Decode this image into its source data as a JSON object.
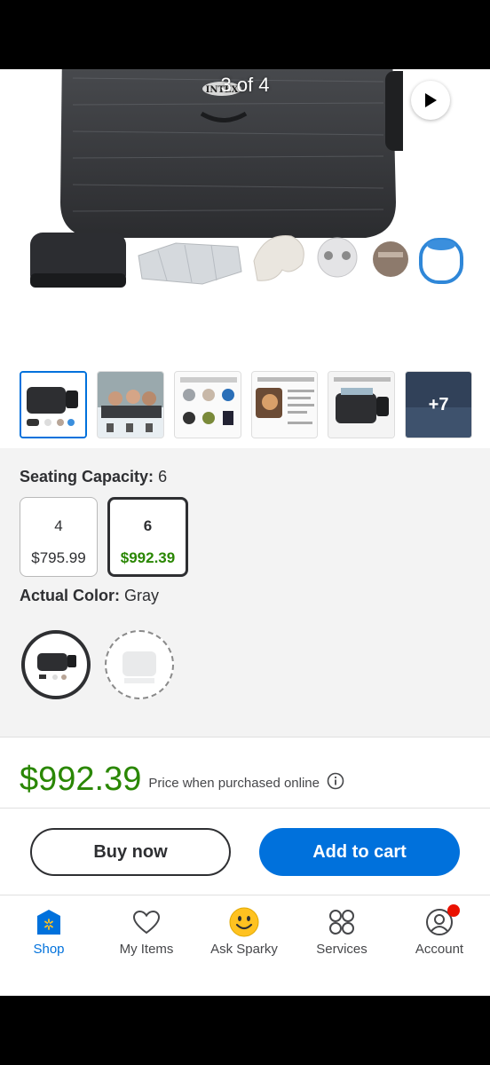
{
  "gallery": {
    "counter": "3 of 4",
    "play_label": "Play video",
    "brand_mark": "INTEX",
    "thumbnails": [
      {
        "name": "thumb-spa-set",
        "selected": true
      },
      {
        "name": "thumb-lifestyle",
        "selected": false
      },
      {
        "name": "thumb-features",
        "selected": false
      },
      {
        "name": "thumb-specs",
        "selected": false
      },
      {
        "name": "thumb-deluxe",
        "selected": false
      },
      {
        "name": "thumb-more",
        "overlay": "+7",
        "selected": false
      }
    ]
  },
  "seating": {
    "label": "Seating Capacity:",
    "value": "6",
    "options": [
      {
        "num": "4",
        "price": "$795.99",
        "selected": false
      },
      {
        "num": "6",
        "price": "$992.39",
        "selected": true
      }
    ]
  },
  "color": {
    "label": "Actual Color:",
    "value": "Gray",
    "swatches": [
      {
        "name": "Gray",
        "selected": true
      },
      {
        "name": "White",
        "selected": false
      }
    ]
  },
  "price": {
    "amount": "$992.39",
    "note": "Price when purchased online"
  },
  "actions": {
    "buy_now": "Buy now",
    "add_to_cart": "Add to cart"
  },
  "tabbar": {
    "items": [
      {
        "label": "Shop",
        "active": true
      },
      {
        "label": "My Items",
        "active": false
      },
      {
        "label": "Ask Sparky",
        "active": false
      },
      {
        "label": "Services",
        "active": false
      },
      {
        "label": "Account",
        "active": false
      }
    ]
  },
  "colors": {
    "accent": "#0071dc",
    "price_green": "#2a8703",
    "text": "#2e2f32",
    "badge_red": "#ea1100",
    "sparky_yellow": "#ffc220"
  }
}
